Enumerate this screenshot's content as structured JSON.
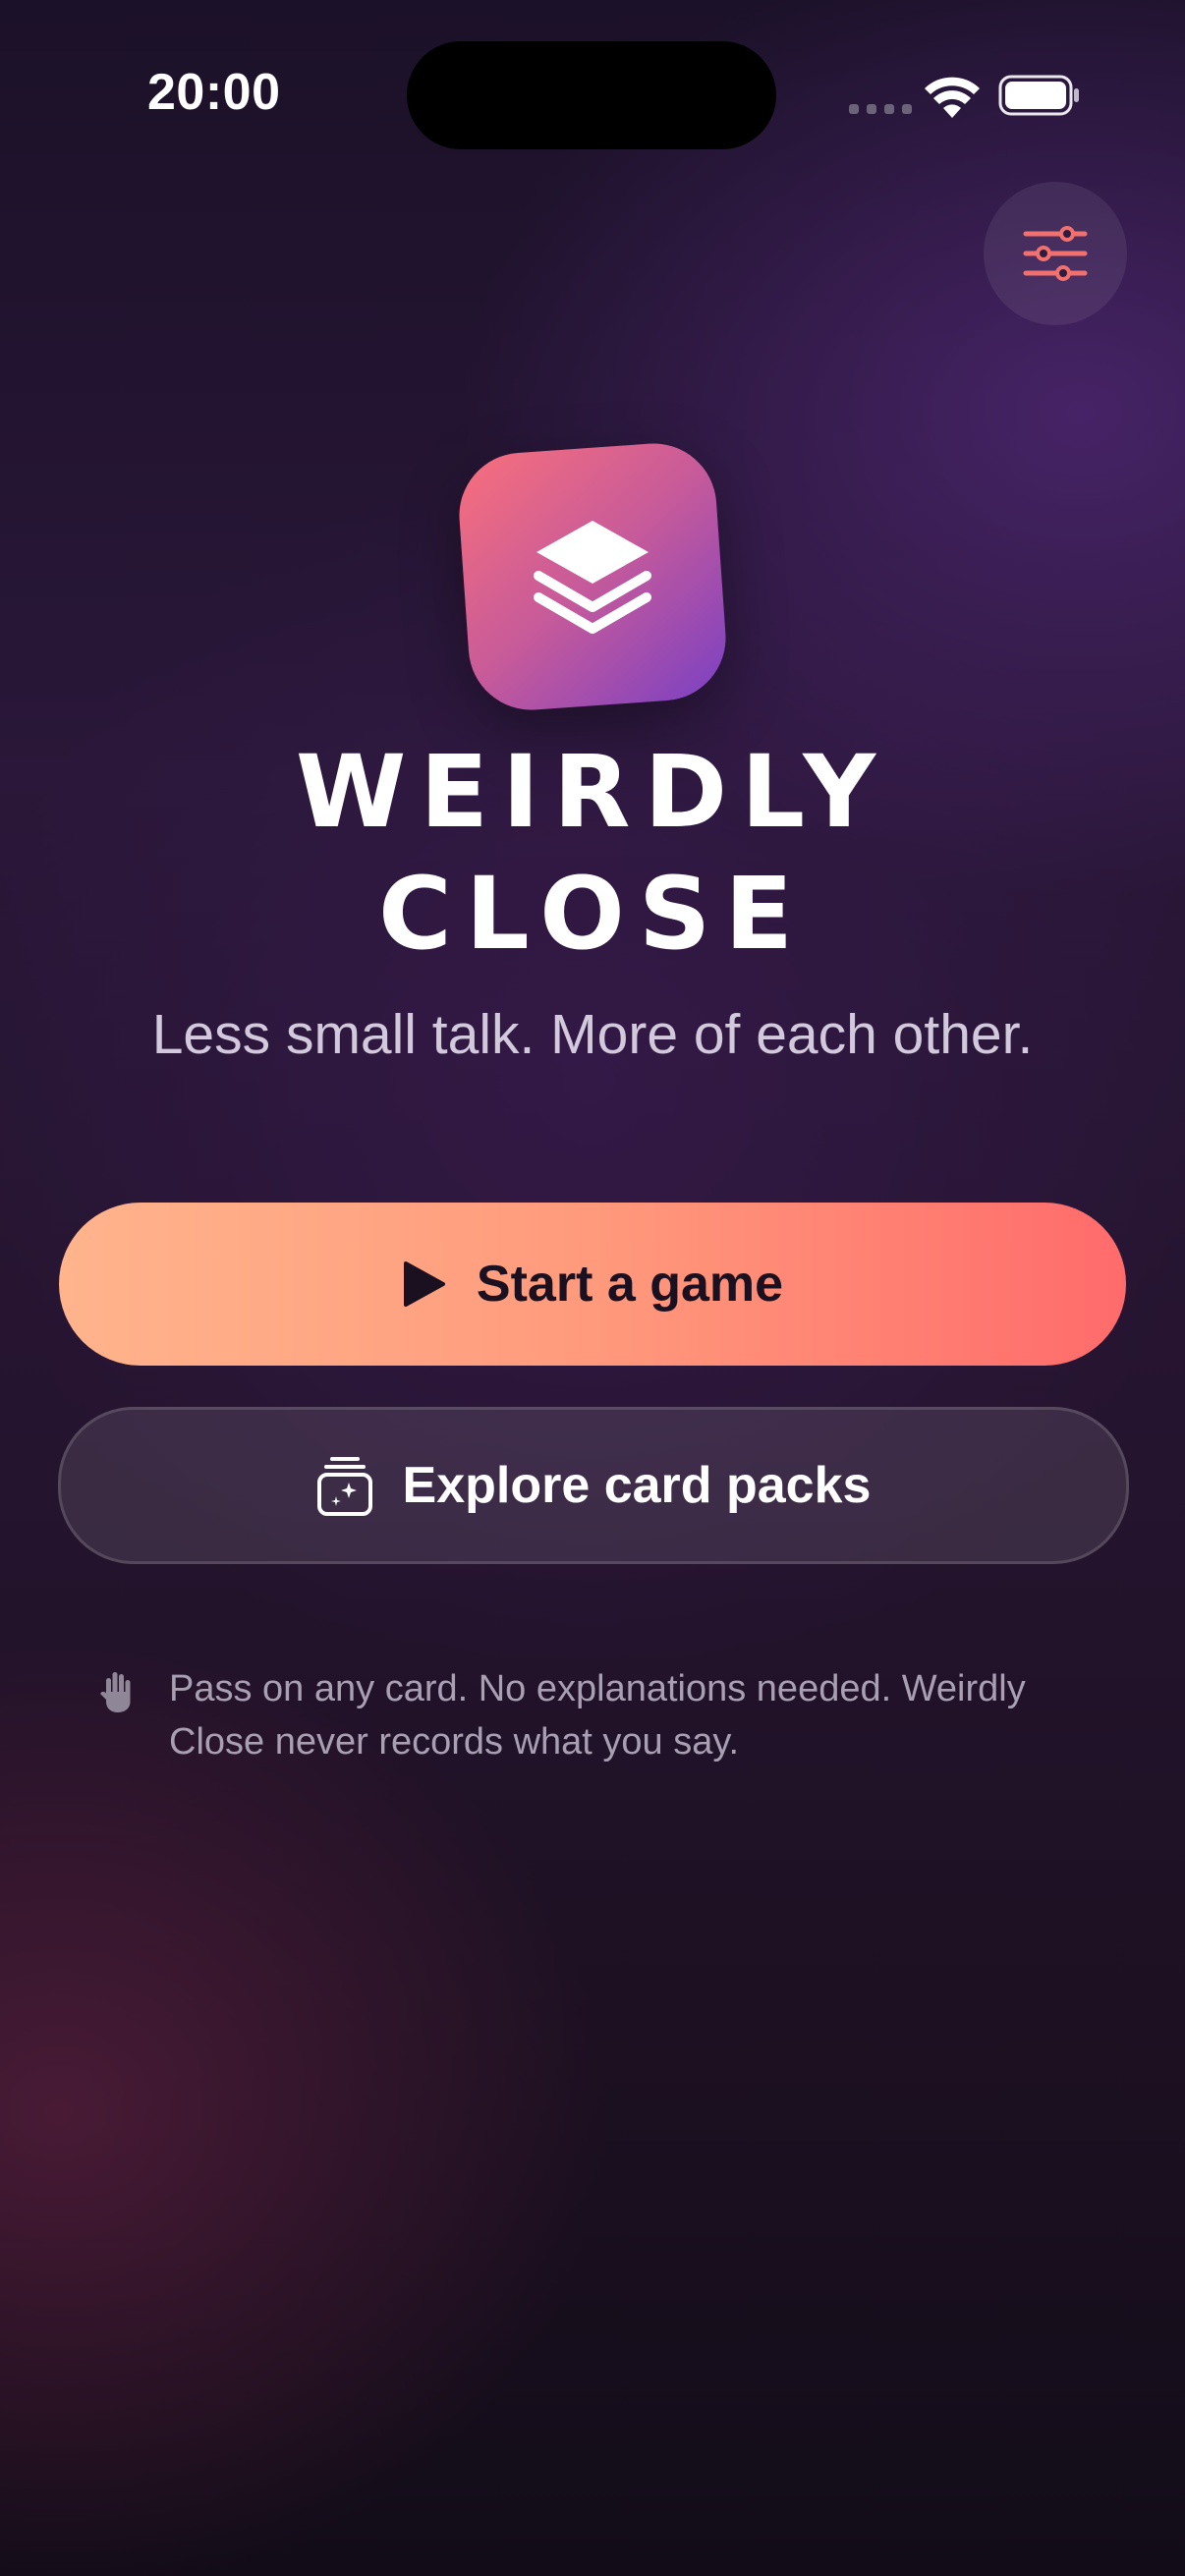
{
  "status_bar": {
    "time": "20:00"
  },
  "header": {
    "settings_icon": "sliders-icon"
  },
  "hero": {
    "app_icon": "stacked-layers-icon",
    "title_line1": "WEIRDLY",
    "title_line2": "CLOSE",
    "tagline": "Less small talk. More of each other."
  },
  "actions": {
    "start_label": "Start a game",
    "start_icon": "play-icon",
    "explore_label": "Explore card packs",
    "explore_icon": "card-packs-icon"
  },
  "note": {
    "icon": "hand-raised-icon",
    "text": "Pass on any card. No explanations needed. Weirdly Close never records what you say."
  },
  "colors": {
    "accent_start": "#ffb48c",
    "accent_end": "#ff6b6b",
    "settings_icon_color": "#f2706e",
    "app_icon_start": "#f86f7c",
    "app_icon_end": "#7a40c4"
  }
}
